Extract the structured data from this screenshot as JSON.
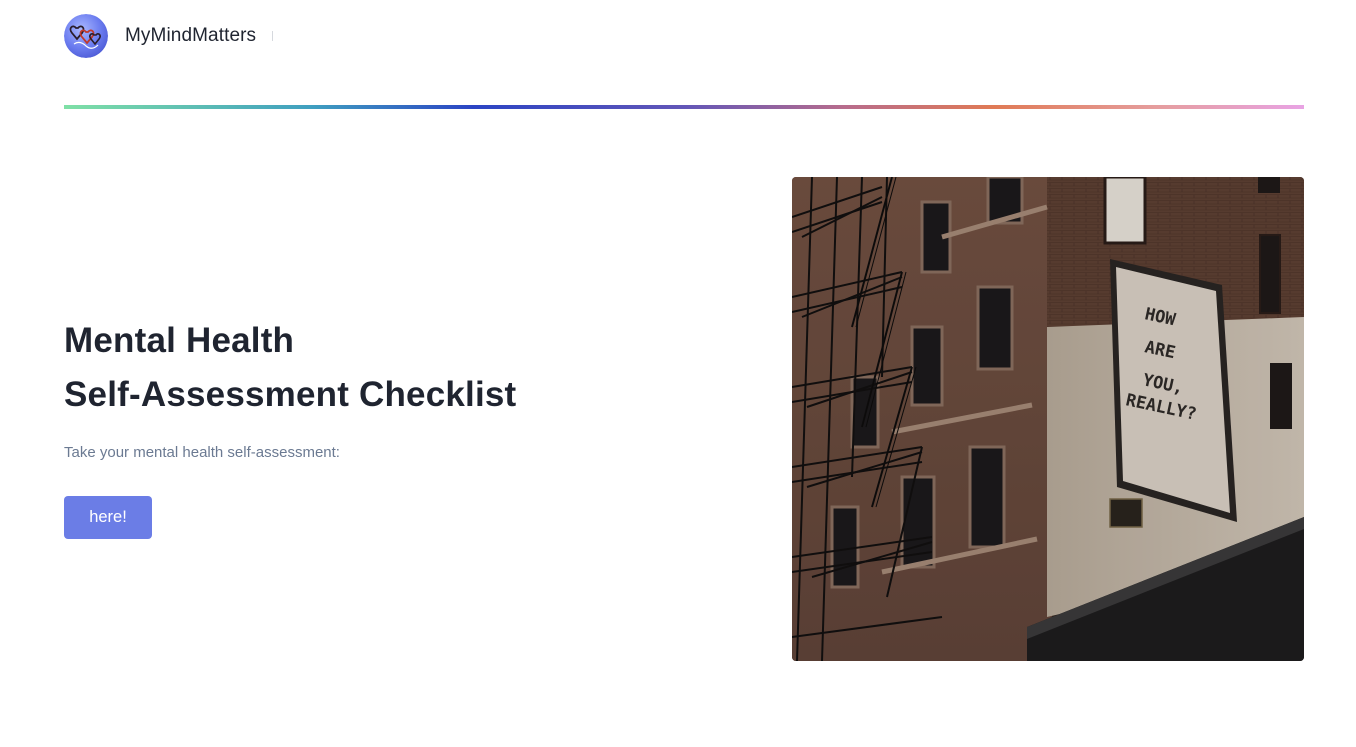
{
  "header": {
    "brand": "MyMindMatters",
    "logo_icon": "hearts-logo-icon"
  },
  "hero": {
    "title_line1": "Mental Health",
    "title_line2": "Self-Assessment Checklist",
    "subtitle": "Take your mental health self-assessment:",
    "cta_label": "here!"
  },
  "photo": {
    "mural_lines": [
      "HOW",
      "ARE",
      "YOU,",
      "REALLY?"
    ]
  },
  "colors": {
    "accent": "#6b7de6",
    "heading": "#1f2430",
    "muted": "#6b7a92"
  }
}
